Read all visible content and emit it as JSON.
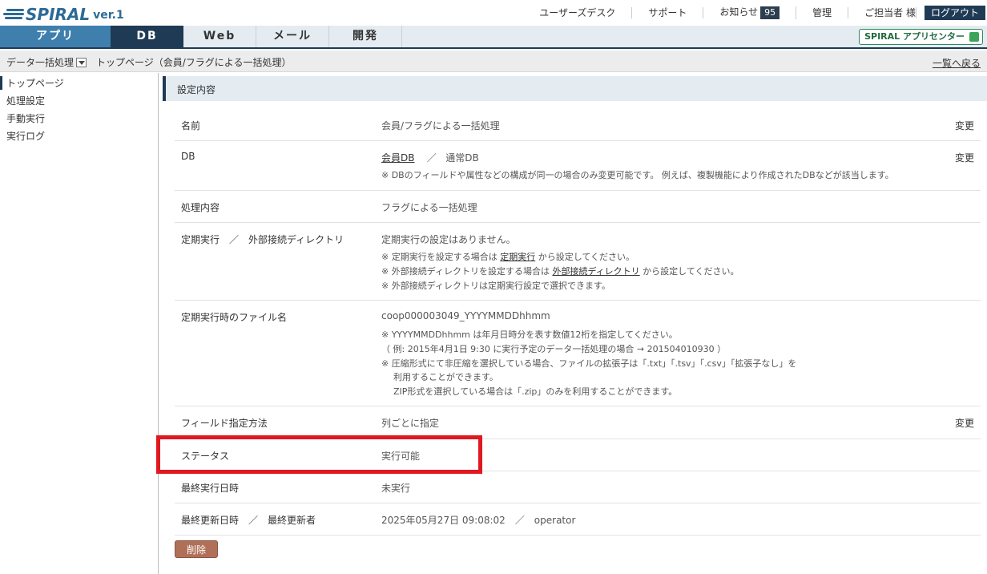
{
  "brand": {
    "name": "SPIRAL",
    "version": "ver.1"
  },
  "top_links": {
    "user_desk": "ユーザーズデスク",
    "support": "サポート",
    "notice": "お知らせ",
    "notice_count": "95",
    "admin": "管理",
    "user": "ご担当者 様",
    "logout": "ログアウト"
  },
  "tabs": [
    "アプリ",
    "DB",
    "Web",
    "メール",
    "開発"
  ],
  "app_center": "SPIRAL アプリセンター",
  "breadcrumb": {
    "section": "データ一括処理",
    "page": "トップページ（会員/フラグによる一括処理）",
    "back": "一覧へ戻る"
  },
  "sidebar": [
    "トップページ",
    "処理設定",
    "手動実行",
    "実行ログ"
  ],
  "section_title": "設定内容",
  "change_label": "変更",
  "rows": {
    "name": {
      "label": "名前",
      "value": "会員/フラグによる一括処理"
    },
    "db": {
      "label": "DB",
      "value_link": "会員DB",
      "separator": "／",
      "value_type": "通常DB",
      "note": "※ DBのフィールドや属性などの構成が同一の場合のみ変更可能です。 例えば、複製機能により作成されたDBなどが該当します。"
    },
    "process": {
      "label": "処理内容",
      "value": "フラグによる一括処理"
    },
    "schedule": {
      "label": "定期実行　／　外部接続ディレクトリ",
      "value": "定期実行の設定はありません。",
      "note1_pre": "※ 定期実行を設定する場合は ",
      "note1_link": "定期実行",
      "note1_post": " から設定してください。",
      "note2_pre": "※ 外部接続ディレクトリを設定する場合は ",
      "note2_link": "外部接続ディレクトリ",
      "note2_post": " から設定してください。",
      "note3": "※ 外部接続ディレクトリは定期実行設定で選択できます。"
    },
    "filename": {
      "label": "定期実行時のファイル名",
      "value": "coop000003049_YYYYMMDDhhmm",
      "note1": "※ YYYYMMDDhhmm は年月日時分を表す数値12桁を指定してください。",
      "note2": "（ 例: 2015年4月1日 9:30 に実行予定のデータ一括処理の場合 → 201504010930 ）",
      "note3": "※ 圧縮形式にて非圧縮を選択している場合、ファイルの拡張子は「.txt」「.tsv」「.csv」「拡張子なし」を",
      "note4": "利用することができます。",
      "note5": "ZIP形式を選択している場合は「.zip」のみを利用することができます。"
    },
    "field_method": {
      "label": "フィールド指定方法",
      "value": "列ごとに指定"
    },
    "status": {
      "label": "ステータス",
      "value": "実行可能"
    },
    "last_run": {
      "label": "最終実行日時",
      "value": "未実行"
    },
    "last_update": {
      "label": "最終更新日時　／　最終更新者",
      "value": "2025年05月27日 09:08:02　／　operator"
    }
  },
  "delete_button": "削除",
  "colors": {
    "navy": "#1f3a54",
    "app_tab": "#3e7fae",
    "highlight": "#e0181f",
    "delete": "#b07058"
  }
}
